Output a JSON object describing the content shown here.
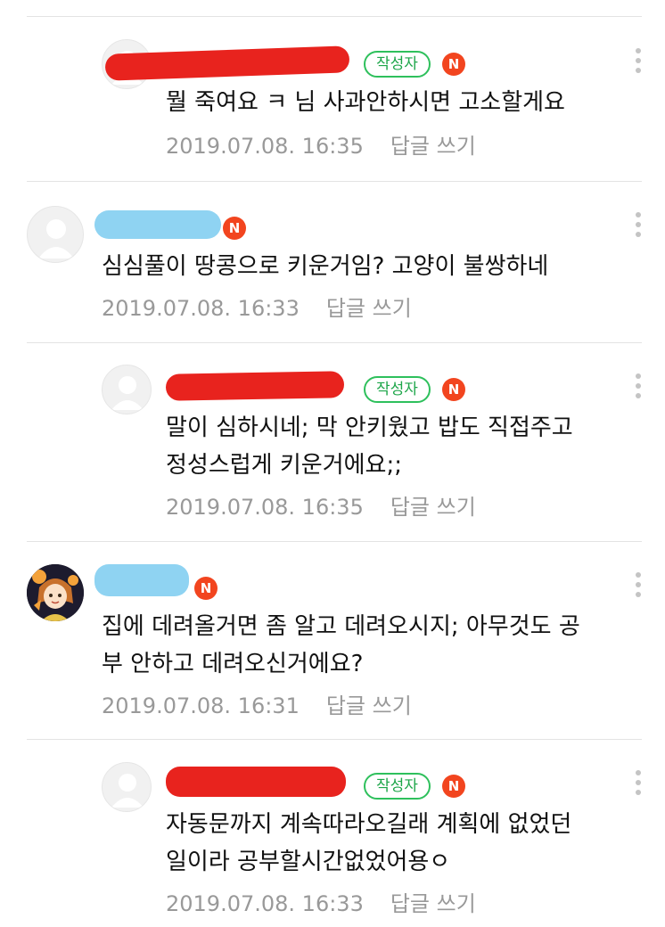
{
  "labels": {
    "author_badge": "작성자",
    "new_badge": "N",
    "reply_action": "답글 쓰기"
  },
  "colors": {
    "author_badge_border": "#2ec05c",
    "new_badge": "#f2451f",
    "redaction_red": "#e8231e",
    "redaction_blue": "#8fd3f2"
  },
  "comments": [
    {
      "line1": "뭘 죽여요 ㅋ 님 사과안하시면 고소할게요",
      "line2": "",
      "date": "2019.07.08. 16:35"
    },
    {
      "line1": "심심풀이 땅콩으로 키운거임?  고양이 불쌍하네",
      "line2": "",
      "date": "2019.07.08. 16:33"
    },
    {
      "line1": "말이 심하시네; 막 안키웠고 밥도 직접주고",
      "line2": "정성스럽게 키운거에요;;",
      "date": "2019.07.08. 16:35"
    },
    {
      "line1": "집에 데려올거면 좀 알고 데려오시지; 아무것도 공",
      "line2": "부 안하고 데려오신거에요?",
      "date": "2019.07.08. 16:31"
    },
    {
      "line1": "자동문까지 계속따라오길래 계획에 없었던",
      "line2": "일이라 공부할시간없었어용ㅇ",
      "date": "2019.07.08. 16:33"
    }
  ]
}
